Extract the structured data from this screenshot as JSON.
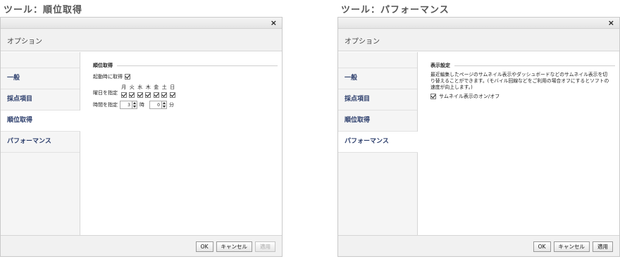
{
  "left": {
    "panel_title": "ツール：順位取得",
    "dialog": {
      "close": "×",
      "header": "オプション",
      "nav": [
        "一般",
        "採点項目",
        "順位取得",
        "パフォーマンス"
      ],
      "section_title": "順位取得",
      "startup_label": "起動時に取得",
      "weekday_label": "曜日を指定",
      "days": [
        "月",
        "火",
        "水",
        "木",
        "金",
        "土",
        "日"
      ],
      "time_label": "時間を指定",
      "hour_value": "3",
      "hour_unit": "時",
      "minute_value": "0",
      "minute_unit": "分",
      "buttons": {
        "ok": "OK",
        "cancel": "キャンセル",
        "apply": "適用"
      }
    }
  },
  "right": {
    "panel_title": "ツール：パフォーマンス",
    "dialog": {
      "close": "×",
      "header": "オプション",
      "nav": [
        "一般",
        "採点項目",
        "順位取得",
        "パフォーマンス"
      ],
      "section_title": "表示設定",
      "description": "最近編集したページのサムネイル表示やダッシュボードなどのサムネイル表示を切り替えることができます。(モバイル回線などをご利用の場合オフにするとソフトの速度が向上します。)",
      "thumbnail_toggle_label": "サムネイル表示のオン/オフ",
      "buttons": {
        "ok": "OK",
        "cancel": "キャンセル",
        "apply": "適用"
      }
    }
  }
}
